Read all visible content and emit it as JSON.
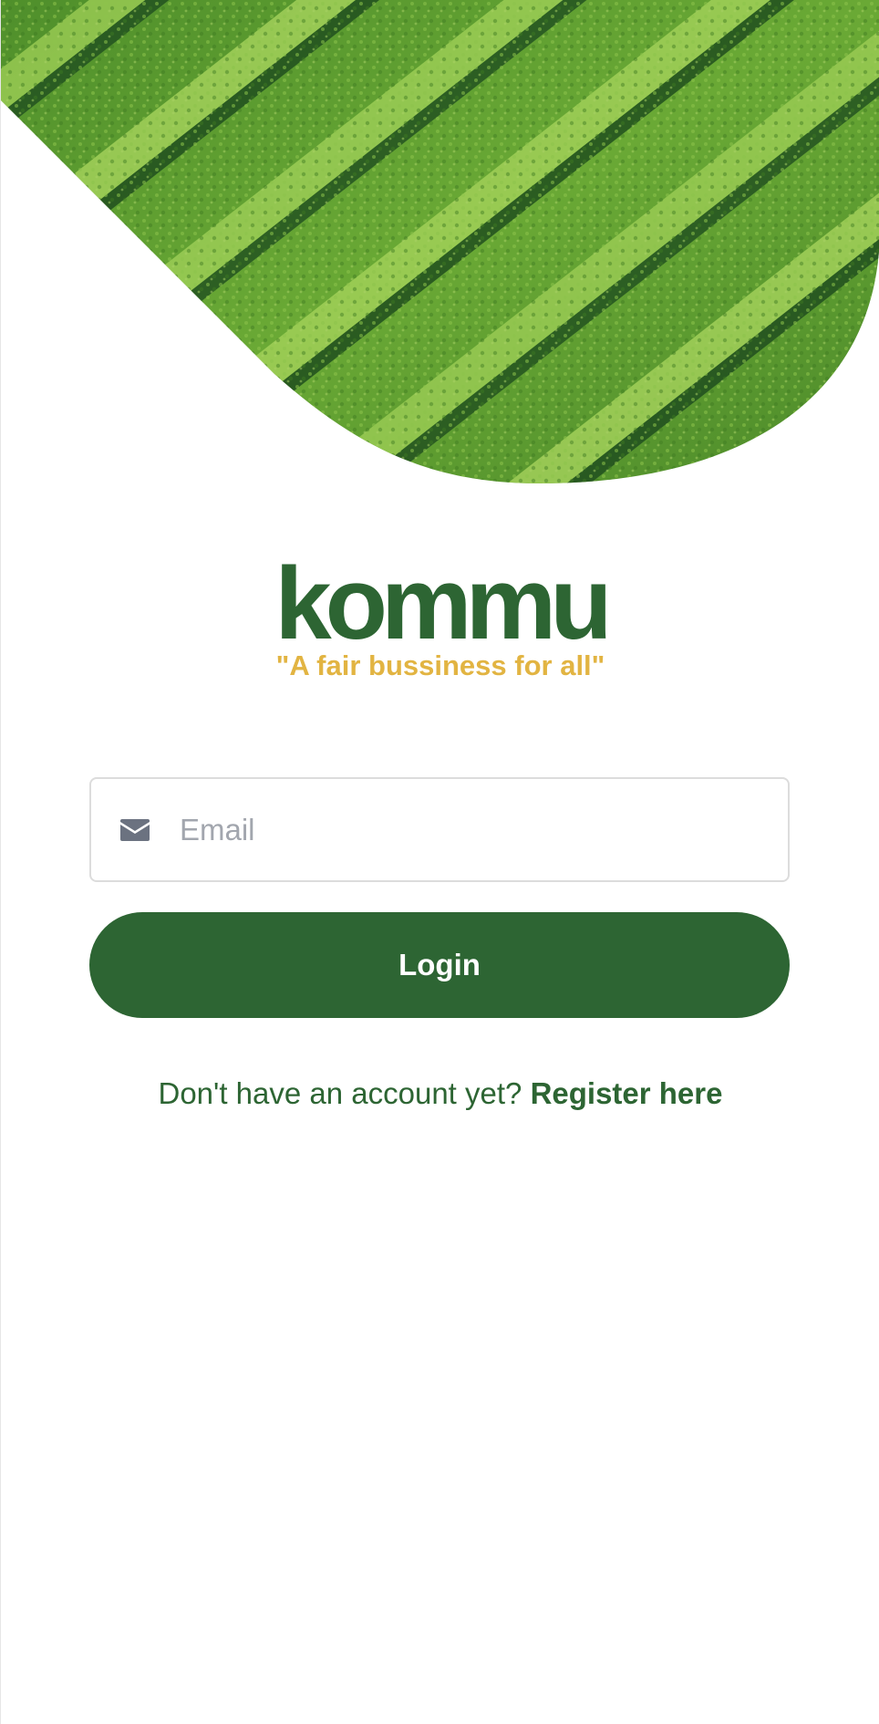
{
  "hero": {
    "image": "green-crop-rows-field"
  },
  "brand": {
    "logo_text": "kommu",
    "tagline": "\"A fair bussiness for all\""
  },
  "email_field": {
    "icon": "envelope-icon",
    "placeholder": "Email",
    "value": ""
  },
  "login_button": {
    "label": "Login"
  },
  "register": {
    "prompt": "Don't have an account yet?",
    "link_label": "Register here"
  },
  "colors": {
    "brand_green": "#2d6533",
    "tagline_gold": "#e2b442",
    "placeholder_gray": "#a2a6ae",
    "icon_gray": "#6b7280"
  }
}
